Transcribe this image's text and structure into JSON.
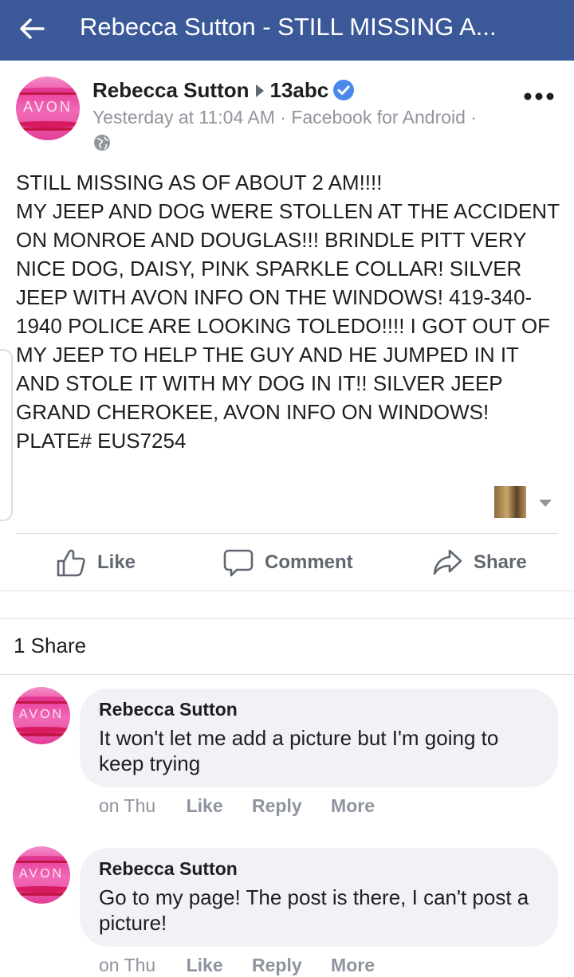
{
  "topbar": {
    "title": "Rebecca Sutton - STILL MISSING A..."
  },
  "post": {
    "author": "Rebecca Sutton",
    "target": "13abc",
    "meta": "Yesterday at 11:04 AM · Facebook for Android ·",
    "avatar_text": "AVON",
    "body": "STILL MISSING AS OF ABOUT 2 AM!!!!\nMY JEEP AND DOG WERE STOLLEN AT THE ACCIDENT ON MONROE AND DOUGLAS!!! BRINDLE PITT VERY NICE DOG, DAISY, PINK SPARKLE COLLAR! SILVER JEEP WITH AVON INFO ON THE WINDOWS! 419-340-1940 POLICE ARE LOOKING TOLEDO!!!! I GOT OUT OF MY JEEP TO HELP THE GUY AND HE JUMPED IN IT AND STOLE IT WITH MY DOG IN IT!! SILVER JEEP GRAND CHEROKEE, AVON INFO ON WINDOWS! PLATE# EUS7254"
  },
  "actions": {
    "like": "Like",
    "comment": "Comment",
    "share": "Share"
  },
  "shares": "1 Share",
  "comments": [
    {
      "name": "Rebecca Sutton",
      "text": "It won't let me add a picture but I'm going to keep trying",
      "time": "on Thu",
      "like": "Like",
      "reply": "Reply",
      "more": "More",
      "avatar_text": "AVON"
    },
    {
      "name": "Rebecca Sutton",
      "text": "Go to my page! The post is there, I can't post a picture!",
      "time": "on Thu",
      "like": "Like",
      "reply": "Reply",
      "more": "More",
      "avatar_text": "AVON"
    }
  ],
  "colors": {
    "header": "#3b5998",
    "verified": "#4b88ee",
    "bubble": "#f0f2f5",
    "muted": "#90949c"
  }
}
